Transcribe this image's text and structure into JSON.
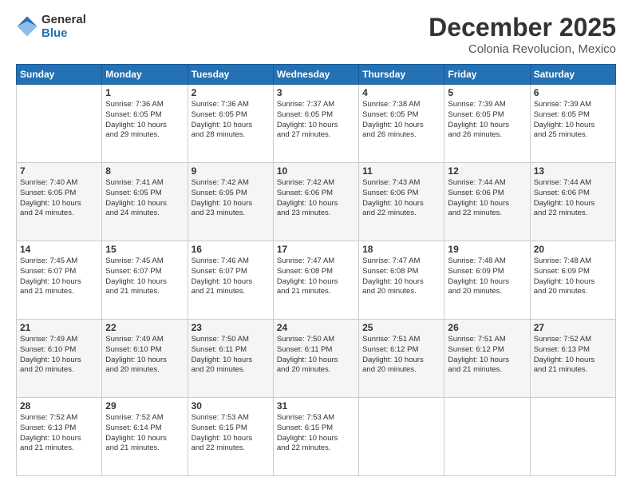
{
  "header": {
    "logo_line1": "General",
    "logo_line2": "Blue",
    "month_title": "December 2025",
    "subtitle": "Colonia Revolucion, Mexico"
  },
  "days_of_week": [
    "Sunday",
    "Monday",
    "Tuesday",
    "Wednesday",
    "Thursday",
    "Friday",
    "Saturday"
  ],
  "weeks": [
    [
      {
        "day": "",
        "info": ""
      },
      {
        "day": "1",
        "info": "Sunrise: 7:36 AM\nSunset: 6:05 PM\nDaylight: 10 hours\nand 29 minutes."
      },
      {
        "day": "2",
        "info": "Sunrise: 7:36 AM\nSunset: 6:05 PM\nDaylight: 10 hours\nand 28 minutes."
      },
      {
        "day": "3",
        "info": "Sunrise: 7:37 AM\nSunset: 6:05 PM\nDaylight: 10 hours\nand 27 minutes."
      },
      {
        "day": "4",
        "info": "Sunrise: 7:38 AM\nSunset: 6:05 PM\nDaylight: 10 hours\nand 26 minutes."
      },
      {
        "day": "5",
        "info": "Sunrise: 7:39 AM\nSunset: 6:05 PM\nDaylight: 10 hours\nand 26 minutes."
      },
      {
        "day": "6",
        "info": "Sunrise: 7:39 AM\nSunset: 6:05 PM\nDaylight: 10 hours\nand 25 minutes."
      }
    ],
    [
      {
        "day": "7",
        "info": "Sunrise: 7:40 AM\nSunset: 6:05 PM\nDaylight: 10 hours\nand 24 minutes."
      },
      {
        "day": "8",
        "info": "Sunrise: 7:41 AM\nSunset: 6:05 PM\nDaylight: 10 hours\nand 24 minutes."
      },
      {
        "day": "9",
        "info": "Sunrise: 7:42 AM\nSunset: 6:05 PM\nDaylight: 10 hours\nand 23 minutes."
      },
      {
        "day": "10",
        "info": "Sunrise: 7:42 AM\nSunset: 6:06 PM\nDaylight: 10 hours\nand 23 minutes."
      },
      {
        "day": "11",
        "info": "Sunrise: 7:43 AM\nSunset: 6:06 PM\nDaylight: 10 hours\nand 22 minutes."
      },
      {
        "day": "12",
        "info": "Sunrise: 7:44 AM\nSunset: 6:06 PM\nDaylight: 10 hours\nand 22 minutes."
      },
      {
        "day": "13",
        "info": "Sunrise: 7:44 AM\nSunset: 6:06 PM\nDaylight: 10 hours\nand 22 minutes."
      }
    ],
    [
      {
        "day": "14",
        "info": "Sunrise: 7:45 AM\nSunset: 6:07 PM\nDaylight: 10 hours\nand 21 minutes."
      },
      {
        "day": "15",
        "info": "Sunrise: 7:45 AM\nSunset: 6:07 PM\nDaylight: 10 hours\nand 21 minutes."
      },
      {
        "day": "16",
        "info": "Sunrise: 7:46 AM\nSunset: 6:07 PM\nDaylight: 10 hours\nand 21 minutes."
      },
      {
        "day": "17",
        "info": "Sunrise: 7:47 AM\nSunset: 6:08 PM\nDaylight: 10 hours\nand 21 minutes."
      },
      {
        "day": "18",
        "info": "Sunrise: 7:47 AM\nSunset: 6:08 PM\nDaylight: 10 hours\nand 20 minutes."
      },
      {
        "day": "19",
        "info": "Sunrise: 7:48 AM\nSunset: 6:09 PM\nDaylight: 10 hours\nand 20 minutes."
      },
      {
        "day": "20",
        "info": "Sunrise: 7:48 AM\nSunset: 6:09 PM\nDaylight: 10 hours\nand 20 minutes."
      }
    ],
    [
      {
        "day": "21",
        "info": "Sunrise: 7:49 AM\nSunset: 6:10 PM\nDaylight: 10 hours\nand 20 minutes."
      },
      {
        "day": "22",
        "info": "Sunrise: 7:49 AM\nSunset: 6:10 PM\nDaylight: 10 hours\nand 20 minutes."
      },
      {
        "day": "23",
        "info": "Sunrise: 7:50 AM\nSunset: 6:11 PM\nDaylight: 10 hours\nand 20 minutes."
      },
      {
        "day": "24",
        "info": "Sunrise: 7:50 AM\nSunset: 6:11 PM\nDaylight: 10 hours\nand 20 minutes."
      },
      {
        "day": "25",
        "info": "Sunrise: 7:51 AM\nSunset: 6:12 PM\nDaylight: 10 hours\nand 20 minutes."
      },
      {
        "day": "26",
        "info": "Sunrise: 7:51 AM\nSunset: 6:12 PM\nDaylight: 10 hours\nand 21 minutes."
      },
      {
        "day": "27",
        "info": "Sunrise: 7:52 AM\nSunset: 6:13 PM\nDaylight: 10 hours\nand 21 minutes."
      }
    ],
    [
      {
        "day": "28",
        "info": "Sunrise: 7:52 AM\nSunset: 6:13 PM\nDaylight: 10 hours\nand 21 minutes."
      },
      {
        "day": "29",
        "info": "Sunrise: 7:52 AM\nSunset: 6:14 PM\nDaylight: 10 hours\nand 21 minutes."
      },
      {
        "day": "30",
        "info": "Sunrise: 7:53 AM\nSunset: 6:15 PM\nDaylight: 10 hours\nand 22 minutes."
      },
      {
        "day": "31",
        "info": "Sunrise: 7:53 AM\nSunset: 6:15 PM\nDaylight: 10 hours\nand 22 minutes."
      },
      {
        "day": "",
        "info": ""
      },
      {
        "day": "",
        "info": ""
      },
      {
        "day": "",
        "info": ""
      }
    ]
  ]
}
